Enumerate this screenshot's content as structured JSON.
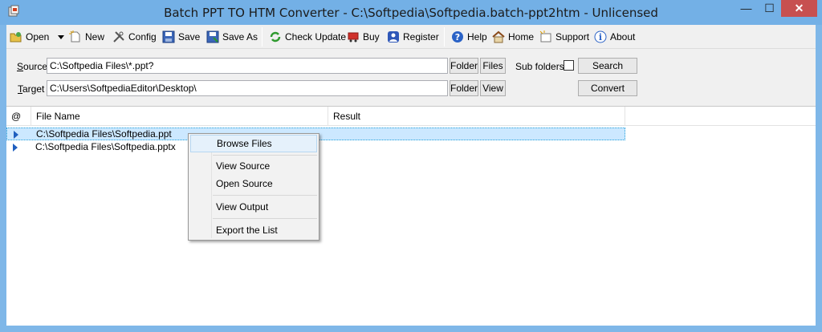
{
  "window": {
    "title": "Batch PPT TO HTM Converter - C:\\Softpedia\\Softpedia.batch-ppt2htm - Unlicensed",
    "min_glyph": "—",
    "max_glyph": "☐",
    "close_glyph": "✕"
  },
  "toolbar": {
    "open": "Open",
    "new": "New",
    "config": "Config",
    "save": "Save",
    "save_as": "Save As",
    "check_update": "Check Update",
    "buy": "Buy",
    "register": "Register",
    "help": "Help",
    "home": "Home",
    "support": "Support",
    "about": "About"
  },
  "source": {
    "label_accel": "S",
    "label_rest": "ource",
    "value": "C:\\Softpedia Files\\*.ppt?",
    "folder_btn": "Folder",
    "files_btn": "Files",
    "subfolders_label": "Sub folders",
    "subfolders_checked": false,
    "search_btn": "Search"
  },
  "target": {
    "label_accel": "T",
    "label_rest": "arget",
    "value": "C:\\Users\\SoftpediaEditor\\Desktop\\",
    "folder_btn": "Folder",
    "view_btn": "View",
    "convert_btn": "Convert"
  },
  "list": {
    "columns": [
      "@",
      "File Name",
      "Result"
    ],
    "rows": [
      {
        "file": "C:\\Softpedia Files\\Softpedia.ppt",
        "result": ""
      },
      {
        "file": "C:\\Softpedia Files\\Softpedia.pptx",
        "result": ""
      }
    ]
  },
  "context_menu": {
    "items": [
      "Browse Files",
      "View  Source",
      "Open Source",
      "View  Output",
      "Export the List"
    ]
  }
}
